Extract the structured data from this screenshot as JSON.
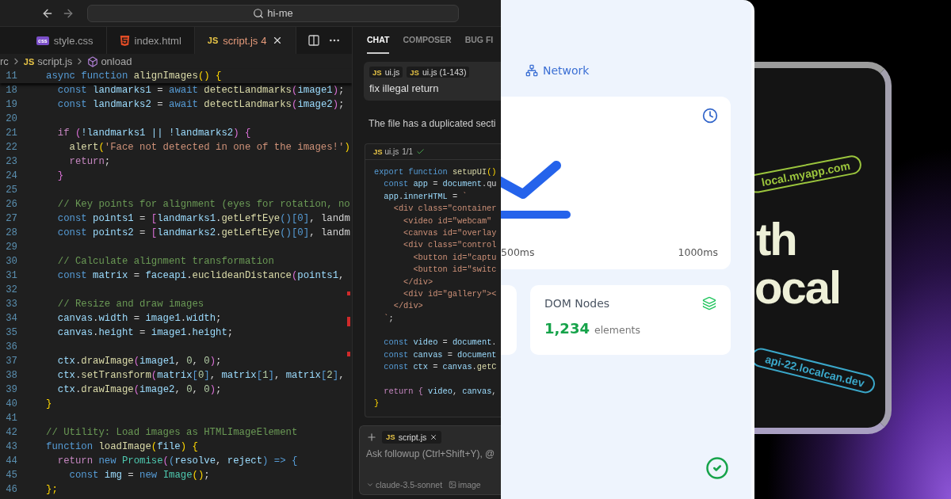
{
  "title_bar": {
    "search": {
      "value": "hi-me"
    }
  },
  "editor_tabs": [
    {
      "label": "style.css",
      "kind": "css",
      "icon": "css",
      "selected": false
    },
    {
      "label": "index.html",
      "kind": "html",
      "selected": false
    },
    {
      "label": "script.js",
      "kind": "js",
      "icon": "JS",
      "problems": "4",
      "selected": true
    }
  ],
  "breadcrumb": [
    {
      "kind": "folder",
      "label": "rc"
    },
    {
      "kind": "file",
      "icon": "JS",
      "label": "script.js"
    },
    {
      "kind": "symbol",
      "label": "onload"
    }
  ],
  "editor": {
    "sticky_line": {
      "number": "11",
      "tokens": [
        {
          "kind": "keyword",
          "text": "async function "
        },
        {
          "kind": "fn",
          "text": "alignImages"
        },
        {
          "kind": "brace",
          "text": "() {"
        }
      ]
    },
    "lines": [
      {
        "number": "18",
        "tokens": [
          {
            "kind": "keyword",
            "text": "  const "
          },
          {
            "kind": "var",
            "text": "landmarks1 "
          },
          {
            "kind": "plain",
            "text": "= "
          },
          {
            "kind": "keyword",
            "text": "await "
          },
          {
            "kind": "fn",
            "text": "detectLandmarks"
          },
          {
            "kind": "paren",
            "text": "("
          },
          {
            "kind": "var",
            "text": "image1"
          },
          {
            "kind": "paren",
            "text": ")"
          },
          {
            "kind": "plain",
            "text": ";"
          }
        ]
      },
      {
        "number": "19",
        "tokens": [
          {
            "kind": "keyword",
            "text": "  const "
          },
          {
            "kind": "var",
            "text": "landmarks2 "
          },
          {
            "kind": "plain",
            "text": "= "
          },
          {
            "kind": "keyword",
            "text": "await "
          },
          {
            "kind": "fn",
            "text": "detectLandmarks"
          },
          {
            "kind": "paren",
            "text": "("
          },
          {
            "kind": "var",
            "text": "image2"
          },
          {
            "kind": "paren",
            "text": ")"
          },
          {
            "kind": "plain",
            "text": ";"
          }
        ]
      },
      {
        "number": "20"
      },
      {
        "number": "21",
        "tokens": [
          {
            "kind": "control",
            "text": "  if "
          },
          {
            "kind": "paren",
            "text": "("
          },
          {
            "kind": "var",
            "text": "!landmarks1 || !landmarks2"
          },
          {
            "kind": "paren",
            "text": ") {"
          }
        ]
      },
      {
        "number": "22",
        "tokens": [
          {
            "kind": "fn",
            "text": "    alert"
          },
          {
            "kind": "brace",
            "text": "("
          },
          {
            "kind": "str",
            "text": "'Face not detected in one of the images!'"
          },
          {
            "kind": "brace",
            "text": ")"
          }
        ]
      },
      {
        "number": "23",
        "tokens": [
          {
            "kind": "control",
            "text": "    return"
          },
          {
            "kind": "plain",
            "text": ";"
          }
        ]
      },
      {
        "number": "24",
        "tokens": [
          {
            "kind": "paren",
            "text": "  }"
          }
        ]
      },
      {
        "number": "25"
      },
      {
        "number": "26",
        "tokens": [
          {
            "kind": "comment",
            "text": "  // Key points for alignment (eyes for rotation, no"
          }
        ]
      },
      {
        "number": "27",
        "tokens": [
          {
            "kind": "keyword",
            "text": "  const "
          },
          {
            "kind": "var",
            "text": "points1 "
          },
          {
            "kind": "plain",
            "text": "= "
          },
          {
            "kind": "paren",
            "text": "["
          },
          {
            "kind": "var",
            "text": "landmarks1"
          },
          {
            "kind": "plain",
            "text": "."
          },
          {
            "kind": "fn",
            "text": "getLeftEye"
          },
          {
            "kind": "keyword",
            "text": "()[0]"
          },
          {
            "kind": "plain",
            "text": ", landm"
          }
        ]
      },
      {
        "number": "28",
        "tokens": [
          {
            "kind": "keyword",
            "text": "  const "
          },
          {
            "kind": "var",
            "text": "points2 "
          },
          {
            "kind": "plain",
            "text": "= "
          },
          {
            "kind": "paren",
            "text": "["
          },
          {
            "kind": "var",
            "text": "landmarks2"
          },
          {
            "kind": "plain",
            "text": "."
          },
          {
            "kind": "fn",
            "text": "getLeftEye"
          },
          {
            "kind": "keyword",
            "text": "()[0]"
          },
          {
            "kind": "plain",
            "text": ", landm"
          }
        ]
      },
      {
        "number": "29"
      },
      {
        "number": "30",
        "tokens": [
          {
            "kind": "comment",
            "text": "  // Calculate alignment transformation"
          }
        ]
      },
      {
        "number": "31",
        "tokens": [
          {
            "kind": "keyword",
            "text": "  const "
          },
          {
            "kind": "var",
            "text": "matrix "
          },
          {
            "kind": "plain",
            "text": "= "
          },
          {
            "kind": "var",
            "text": "faceapi"
          },
          {
            "kind": "plain",
            "text": "."
          },
          {
            "kind": "fn",
            "text": "euclideanDistance"
          },
          {
            "kind": "paren",
            "text": "("
          },
          {
            "kind": "var",
            "text": "points1"
          },
          {
            "kind": "plain",
            "text": ","
          }
        ]
      },
      {
        "number": "32"
      },
      {
        "number": "33",
        "tokens": [
          {
            "kind": "comment",
            "text": "  // Resize and draw images"
          }
        ]
      },
      {
        "number": "34",
        "tokens": [
          {
            "kind": "var",
            "text": "  canvas"
          },
          {
            "kind": "plain",
            "text": "."
          },
          {
            "kind": "var",
            "text": "width "
          },
          {
            "kind": "plain",
            "text": "= "
          },
          {
            "kind": "var",
            "text": "image1"
          },
          {
            "kind": "plain",
            "text": "."
          },
          {
            "kind": "var",
            "text": "width"
          },
          {
            "kind": "plain",
            "text": ";"
          }
        ]
      },
      {
        "number": "35",
        "tokens": [
          {
            "kind": "var",
            "text": "  canvas"
          },
          {
            "kind": "plain",
            "text": "."
          },
          {
            "kind": "var",
            "text": "height "
          },
          {
            "kind": "plain",
            "text": "= "
          },
          {
            "kind": "var",
            "text": "image1"
          },
          {
            "kind": "plain",
            "text": "."
          },
          {
            "kind": "var",
            "text": "height"
          },
          {
            "kind": "plain",
            "text": ";"
          }
        ]
      },
      {
        "number": "36"
      },
      {
        "number": "37",
        "tokens": [
          {
            "kind": "var",
            "text": "  ctx"
          },
          {
            "kind": "plain",
            "text": "."
          },
          {
            "kind": "fn",
            "text": "drawImage"
          },
          {
            "kind": "paren",
            "text": "("
          },
          {
            "kind": "var",
            "text": "image1"
          },
          {
            "kind": "plain",
            "text": ", "
          },
          {
            "kind": "num",
            "text": "0"
          },
          {
            "kind": "plain",
            "text": ", "
          },
          {
            "kind": "num",
            "text": "0"
          },
          {
            "kind": "paren",
            "text": ")"
          },
          {
            "kind": "plain",
            "text": ";"
          }
        ]
      },
      {
        "number": "38",
        "tokens": [
          {
            "kind": "var",
            "text": "  ctx"
          },
          {
            "kind": "plain",
            "text": "."
          },
          {
            "kind": "fn",
            "text": "setTransform"
          },
          {
            "kind": "paren",
            "text": "("
          },
          {
            "kind": "var",
            "text": "matrix"
          },
          {
            "kind": "keyword",
            "text": "["
          },
          {
            "kind": "num",
            "text": "0"
          },
          {
            "kind": "keyword",
            "text": "]"
          },
          {
            "kind": "plain",
            "text": ", "
          },
          {
            "kind": "var",
            "text": "matrix"
          },
          {
            "kind": "keyword",
            "text": "["
          },
          {
            "kind": "num",
            "text": "1"
          },
          {
            "kind": "keyword",
            "text": "]"
          },
          {
            "kind": "plain",
            "text": ", "
          },
          {
            "kind": "var",
            "text": "matrix"
          },
          {
            "kind": "keyword",
            "text": "["
          },
          {
            "kind": "num",
            "text": "2"
          },
          {
            "kind": "keyword",
            "text": "]"
          },
          {
            "kind": "plain",
            "text": ","
          }
        ]
      },
      {
        "number": "39",
        "tokens": [
          {
            "kind": "var",
            "text": "  ctx"
          },
          {
            "kind": "plain",
            "text": "."
          },
          {
            "kind": "fn",
            "text": "drawImage"
          },
          {
            "kind": "paren",
            "text": "("
          },
          {
            "kind": "var",
            "text": "image2"
          },
          {
            "kind": "plain",
            "text": ", "
          },
          {
            "kind": "num",
            "text": "0"
          },
          {
            "kind": "plain",
            "text": ", "
          },
          {
            "kind": "num",
            "text": "0"
          },
          {
            "kind": "paren",
            "text": ")"
          },
          {
            "kind": "plain",
            "text": ";"
          }
        ]
      },
      {
        "number": "40",
        "tokens": [
          {
            "kind": "brace",
            "text": "}"
          }
        ]
      },
      {
        "number": "41"
      },
      {
        "number": "42",
        "tokens": [
          {
            "kind": "comment",
            "text": "// Utility: Load images as HTMLImageElement"
          }
        ]
      },
      {
        "number": "43",
        "tokens": [
          {
            "kind": "keyword",
            "text": "function "
          },
          {
            "kind": "fn",
            "text": "loadImage"
          },
          {
            "kind": "brace",
            "text": "("
          },
          {
            "kind": "var",
            "text": "file"
          },
          {
            "kind": "brace",
            "text": ") {"
          }
        ]
      },
      {
        "number": "44",
        "tokens": [
          {
            "kind": "control",
            "text": "  return "
          },
          {
            "kind": "keyword",
            "text": "new "
          },
          {
            "kind": "type",
            "text": "Promise"
          },
          {
            "kind": "paren",
            "text": "("
          },
          {
            "kind": "keyword",
            "text": "("
          },
          {
            "kind": "var",
            "text": "resolve"
          },
          {
            "kind": "plain",
            "text": ", "
          },
          {
            "kind": "var",
            "text": "reject"
          },
          {
            "kind": "keyword",
            "text": ") => {"
          }
        ]
      },
      {
        "number": "45",
        "tokens": [
          {
            "kind": "keyword",
            "text": "    const "
          },
          {
            "kind": "var",
            "text": "img "
          },
          {
            "kind": "plain",
            "text": "= "
          },
          {
            "kind": "keyword",
            "text": "new "
          },
          {
            "kind": "type",
            "text": "Image"
          },
          {
            "kind": "brace",
            "text": "()"
          },
          {
            "kind": "plain",
            "text": ";"
          }
        ]
      },
      {
        "number": "46",
        "tokens": [
          {
            "kind": "brace",
            "text": "};"
          }
        ]
      }
    ]
  },
  "chat": {
    "tabs": [
      {
        "label": "CHAT",
        "selected": true
      },
      {
        "label": "COMPOSER",
        "selected": false
      },
      {
        "label": "BUG FI",
        "selected": false
      }
    ],
    "message": {
      "chips": [
        {
          "icon": "JS",
          "label": "ui.js"
        },
        {
          "icon": "JS",
          "label": "ui.js (1-143)"
        }
      ],
      "text": "fix illegal return"
    },
    "reply": "The file has a duplicated secti",
    "code_block": {
      "icon": "JS",
      "file": "ui.js",
      "range": "1/1",
      "applied": true,
      "lines": [
        {
          "tokens": [
            {
              "kind": "keyword",
              "text": "export function "
            },
            {
              "kind": "fn",
              "text": "setupUI"
            },
            {
              "kind": "brace",
              "text": "()"
            }
          ]
        },
        {
          "tokens": [
            {
              "kind": "keyword",
              "text": "  const "
            },
            {
              "kind": "var",
              "text": "app "
            },
            {
              "kind": "plain",
              "text": "= "
            },
            {
              "kind": "var",
              "text": "document"
            },
            {
              "kind": "plain",
              "text": ".qu"
            }
          ]
        },
        {
          "tokens": [
            {
              "kind": "var",
              "text": "  app"
            },
            {
              "kind": "plain",
              "text": "."
            },
            {
              "kind": "var",
              "text": "innerHTML "
            },
            {
              "kind": "plain",
              "text": "= "
            },
            {
              "kind": "str",
              "text": "`"
            }
          ]
        },
        {
          "tokens": [
            {
              "kind": "str",
              "text": "    <div class=\"container"
            }
          ]
        },
        {
          "tokens": [
            {
              "kind": "str",
              "text": "      <video id=\"webcam\""
            }
          ]
        },
        {
          "tokens": [
            {
              "kind": "str",
              "text": "      <canvas id=\"overlay"
            }
          ]
        },
        {
          "tokens": [
            {
              "kind": "str",
              "text": "      <div class=\"control"
            }
          ]
        },
        {
          "tokens": [
            {
              "kind": "str",
              "text": "        <button id=\"captu"
            }
          ]
        },
        {
          "tokens": [
            {
              "kind": "str",
              "text": "        <button id=\"switc"
            }
          ]
        },
        {
          "tokens": [
            {
              "kind": "str",
              "text": "      </div>"
            }
          ]
        },
        {
          "tokens": [
            {
              "kind": "str",
              "text": "      <div id=\"gallery\"><"
            }
          ]
        },
        {
          "tokens": [
            {
              "kind": "str",
              "text": "    </div>"
            }
          ]
        },
        {
          "tokens": [
            {
              "kind": "str",
              "text": "  `"
            },
            {
              "kind": "plain",
              "text": ";"
            }
          ]
        },
        {
          "kind": "blank"
        },
        {
          "tokens": [
            {
              "kind": "keyword",
              "text": "  const "
            },
            {
              "kind": "var",
              "text": "video "
            },
            {
              "kind": "plain",
              "text": "= "
            },
            {
              "kind": "var",
              "text": "document"
            },
            {
              "kind": "plain",
              "text": "."
            }
          ]
        },
        {
          "tokens": [
            {
              "kind": "keyword",
              "text": "  const "
            },
            {
              "kind": "var",
              "text": "canvas "
            },
            {
              "kind": "plain",
              "text": "= "
            },
            {
              "kind": "var",
              "text": "document"
            }
          ]
        },
        {
          "tokens": [
            {
              "kind": "keyword",
              "text": "  const "
            },
            {
              "kind": "var",
              "text": "ctx "
            },
            {
              "kind": "plain",
              "text": "= "
            },
            {
              "kind": "var",
              "text": "canvas"
            },
            {
              "kind": "plain",
              "text": "."
            },
            {
              "kind": "fn",
              "text": "getC"
            }
          ]
        },
        {
          "kind": "blank"
        },
        {
          "tokens": [
            {
              "kind": "control",
              "text": "  return "
            },
            {
              "kind": "control",
              "text": "{ "
            },
            {
              "kind": "var",
              "text": "video"
            },
            {
              "kind": "plain",
              "text": ", "
            },
            {
              "kind": "var",
              "text": "canvas"
            },
            {
              "kind": "plain",
              "text": ","
            }
          ]
        },
        {
          "tokens": [
            {
              "kind": "brace",
              "text": "}"
            }
          ]
        }
      ]
    },
    "input": {
      "chip": {
        "icon": "JS",
        "label": "script.js"
      },
      "placeholder": "Ask followup (Ctrl+Shift+Y), @",
      "model": "claude-3.5-sonnet",
      "image_button": "image"
    }
  },
  "dashboard": {
    "nav_item": {
      "label": "Network"
    },
    "timing_card": {
      "axis_labels": [
        "500ms",
        "1000ms"
      ]
    },
    "dom_card": {
      "title": "DOM Nodes",
      "value": "1,234",
      "unit": "elements"
    }
  },
  "promo": {
    "pills": [
      {
        "text": "local.myapp.com",
        "color": "#9bc53d"
      },
      {
        "text": "api-22.localcan.dev",
        "color": "#3aa7c9"
      }
    ],
    "headline": [
      "th",
      "ocal"
    ]
  }
}
